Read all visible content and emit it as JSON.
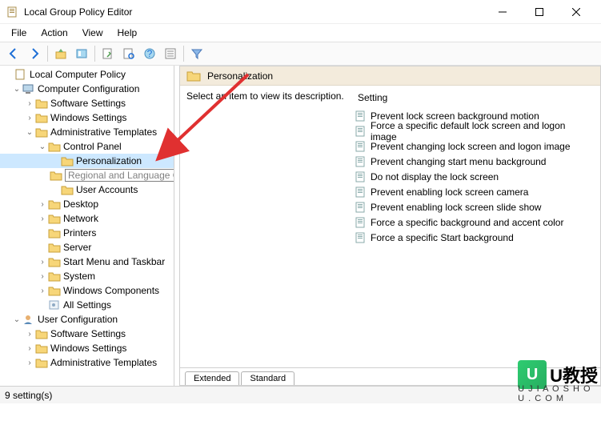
{
  "window": {
    "title": "Local Group Policy Editor"
  },
  "menubar": {
    "file": "File",
    "action": "Action",
    "view": "View",
    "help": "Help"
  },
  "toolbar_icons": [
    "back-icon",
    "forward-icon",
    "up-icon",
    "options-icon",
    "export-icon",
    "refresh-icon",
    "help-icon",
    "properties-icon",
    "filter-icon"
  ],
  "tree": {
    "root": "Local Computer Policy",
    "cc": "Computer Configuration",
    "cc_sw": "Software Settings",
    "cc_win": "Windows Settings",
    "cc_at": "Administrative Templates",
    "cp": "Control Panel",
    "cp_personalization": "Personalization",
    "cp_regional": "Regional and Language Options",
    "cp_user": "User Accounts",
    "at_desktop": "Desktop",
    "at_network": "Network",
    "at_printers": "Printers",
    "at_server": "Server",
    "at_start": "Start Menu and Taskbar",
    "at_system": "System",
    "at_wincomp": "Windows Components",
    "at_all": "All Settings",
    "uc": "User Configuration",
    "uc_sw": "Software Settings",
    "uc_win": "Windows Settings",
    "uc_at": "Administrative Templates"
  },
  "content": {
    "header": "Personalization",
    "desc": "Select an item to view its description.",
    "column": "Setting",
    "settings": [
      "Prevent lock screen background motion",
      "Force a specific default lock screen and logon image",
      "Prevent changing lock screen and logon image",
      "Prevent changing start menu background",
      "Do not display the lock screen",
      "Prevent enabling lock screen camera",
      "Prevent enabling lock screen slide show",
      "Force a specific background and accent color",
      "Force a specific Start background"
    ]
  },
  "tabs": {
    "extended": "Extended",
    "standard": "Standard"
  },
  "statusbar": {
    "text": "9 setting(s)"
  },
  "watermark": {
    "brand": "U教授",
    "url": "U J I A O S H O U . C O M"
  }
}
